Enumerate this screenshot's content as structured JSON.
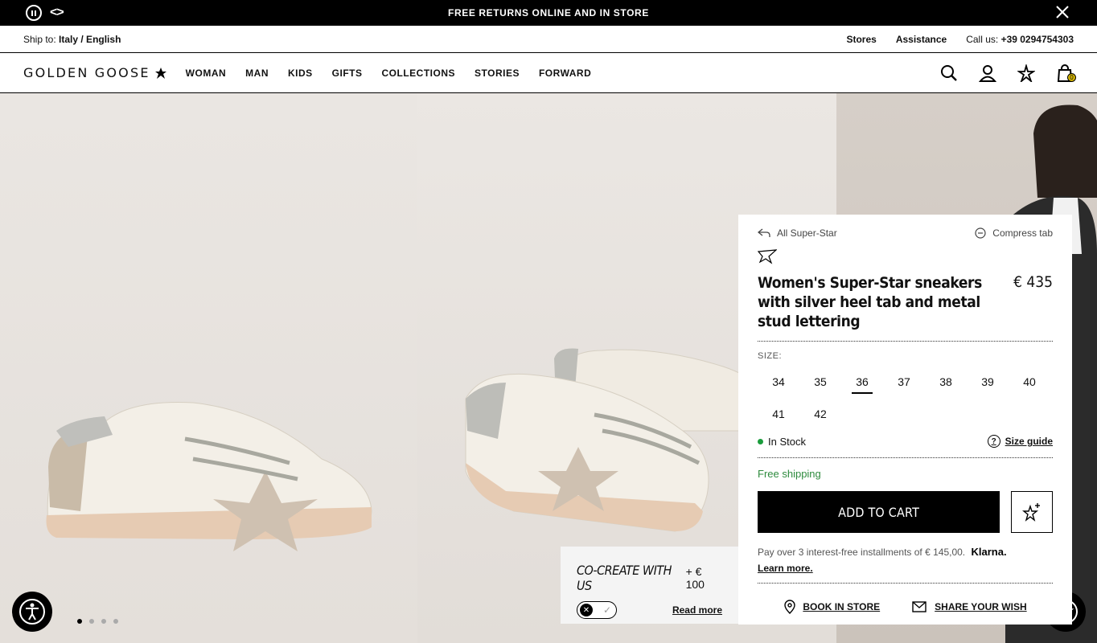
{
  "promo": {
    "text": "FREE RETURNS ONLINE AND IN STORE",
    "arrows": "<>"
  },
  "topbar": {
    "ship_label": "Ship to:",
    "ship_value": "Italy / English",
    "stores": "Stores",
    "assistance": "Assistance",
    "call_label": "Call us:",
    "call_value": "+39 0294754303"
  },
  "nav": {
    "logo": "GOLDEN GOOSE",
    "items": [
      "WOMAN",
      "MAN",
      "KIDS",
      "GIFTS",
      "COLLECTIONS",
      "STORIES",
      "FORWARD"
    ],
    "cart_count": "0"
  },
  "cocreate": {
    "title": "CO-CREATE WITH US",
    "price": "+ € 100",
    "read_more": "Read more"
  },
  "panel": {
    "back_label": "All Super-Star",
    "compress_label": "Compress tab",
    "title": "Women's Super-Star sneakers with silver heel tab and metal stud lettering",
    "price": "€ 435",
    "size_label": "SIZE:",
    "sizes": [
      "34",
      "35",
      "36",
      "37",
      "38",
      "39",
      "40",
      "41",
      "42"
    ],
    "selected_size": "36",
    "stock": "In Stock",
    "size_guide": "Size guide",
    "free_shipping": "Free shipping",
    "add_to_cart": "ADD TO CART",
    "klarna_text": "Pay over 3 interest-free installments of € 145,00.",
    "klarna_brand": "Klarna.",
    "learn_more": "Learn more.",
    "book_in_store": "BOOK IN STORE",
    "share_wish": "SHARE YOUR WISH"
  },
  "colors": {
    "accent": "#000000",
    "stock_green": "#1a9c3c",
    "shipping_green": "#2e8b3e"
  }
}
